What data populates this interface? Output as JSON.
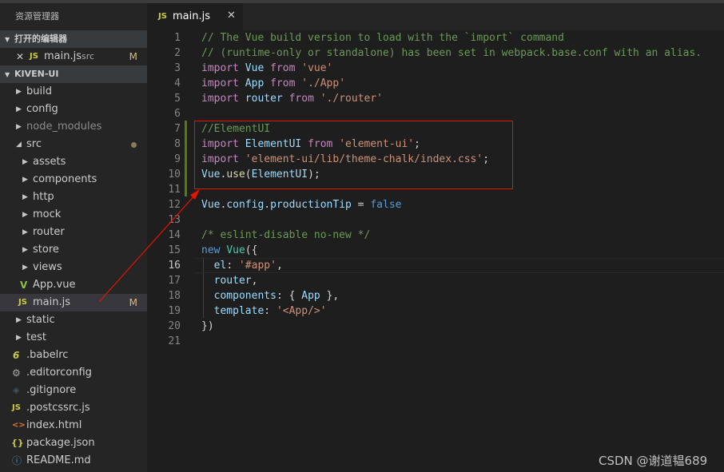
{
  "sidebar": {
    "title": "资源管理器",
    "open_editors": {
      "header": "打开的编辑器",
      "items": [
        {
          "name": "main.js",
          "folder": "src",
          "status": "M"
        }
      ]
    },
    "project": {
      "header": "KIVEN-UI",
      "tree": [
        {
          "name": "build"
        },
        {
          "name": "config"
        },
        {
          "name": "node_modules"
        },
        {
          "name": "src"
        },
        {
          "name": "assets"
        },
        {
          "name": "components"
        },
        {
          "name": "http"
        },
        {
          "name": "mock"
        },
        {
          "name": "router"
        },
        {
          "name": "store"
        },
        {
          "name": "views"
        },
        {
          "name": "App.vue"
        },
        {
          "name": "main.js",
          "status": "M"
        },
        {
          "name": "static"
        },
        {
          "name": "test"
        },
        {
          "name": ".babelrc"
        },
        {
          "name": ".editorconfig"
        },
        {
          "name": ".gitignore"
        },
        {
          "name": ".postcssrc.js"
        },
        {
          "name": "index.html"
        },
        {
          "name": "package.json"
        },
        {
          "name": "README.md"
        }
      ]
    }
  },
  "tab": {
    "label": "main.js",
    "icon": "JS",
    "close": "✕"
  },
  "icons": {
    "js": "JS",
    "vue": "V",
    "babel": "6",
    "gear": "⚙",
    "git": "◈",
    "html": "<>",
    "json": "{}",
    "info": "ⓘ",
    "close": "✕"
  },
  "editor": {
    "current_line": 16,
    "lines": [
      [
        [
          "c-com",
          "// The Vue build version to load with the `import` command"
        ]
      ],
      [
        [
          "c-com",
          "// (runtime-only or standalone) has been set in webpack.base.conf with an alias."
        ]
      ],
      [
        [
          "c-imp",
          "import"
        ],
        [
          "c-txt",
          " "
        ],
        [
          "c-var",
          "Vue"
        ],
        [
          "c-txt",
          " "
        ],
        [
          "c-imp",
          "from"
        ],
        [
          "c-txt",
          " "
        ],
        [
          "c-str",
          "'vue'"
        ]
      ],
      [
        [
          "c-imp",
          "import"
        ],
        [
          "c-txt",
          " "
        ],
        [
          "c-var",
          "App"
        ],
        [
          "c-txt",
          " "
        ],
        [
          "c-imp",
          "from"
        ],
        [
          "c-txt",
          " "
        ],
        [
          "c-str",
          "'./App'"
        ]
      ],
      [
        [
          "c-imp",
          "import"
        ],
        [
          "c-txt",
          " "
        ],
        [
          "c-var",
          "router"
        ],
        [
          "c-txt",
          " "
        ],
        [
          "c-imp",
          "from"
        ],
        [
          "c-txt",
          " "
        ],
        [
          "c-str",
          "'./router'"
        ]
      ],
      [],
      [
        [
          "c-com",
          "//ElementUI"
        ]
      ],
      [
        [
          "c-imp",
          "import"
        ],
        [
          "c-txt",
          " "
        ],
        [
          "c-var",
          "ElementUI"
        ],
        [
          "c-txt",
          " "
        ],
        [
          "c-imp",
          "from"
        ],
        [
          "c-txt",
          " "
        ],
        [
          "c-str",
          "'element-ui'"
        ],
        [
          "c-txt",
          ";"
        ]
      ],
      [
        [
          "c-imp",
          "import"
        ],
        [
          "c-txt",
          " "
        ],
        [
          "c-str",
          "'element-ui/lib/theme-chalk/index.css'"
        ],
        [
          "c-txt",
          ";"
        ]
      ],
      [
        [
          "c-var",
          "Vue"
        ],
        [
          "c-txt",
          "."
        ],
        [
          "c-fn",
          "use"
        ],
        [
          "c-txt",
          "("
        ],
        [
          "c-var",
          "ElementUI"
        ],
        [
          "c-txt",
          ");"
        ]
      ],
      [],
      [
        [
          "c-var",
          "Vue"
        ],
        [
          "c-txt",
          "."
        ],
        [
          "c-var",
          "config"
        ],
        [
          "c-txt",
          "."
        ],
        [
          "c-var",
          "productionTip"
        ],
        [
          "c-txt",
          " = "
        ],
        [
          "c-kw",
          "false"
        ]
      ],
      [],
      [
        [
          "c-com",
          "/* eslint-disable no-new */"
        ]
      ],
      [
        [
          "c-kw",
          "new"
        ],
        [
          "c-txt",
          " "
        ],
        [
          "c-cls",
          "Vue"
        ],
        [
          "c-txt",
          "({"
        ]
      ],
      [
        [
          "c-txt",
          "  "
        ],
        [
          "c-var",
          "el"
        ],
        [
          "c-txt",
          ": "
        ],
        [
          "c-str",
          "'#app'"
        ],
        [
          "c-txt",
          ","
        ]
      ],
      [
        [
          "c-txt",
          "  "
        ],
        [
          "c-var",
          "router"
        ],
        [
          "c-txt",
          ","
        ]
      ],
      [
        [
          "c-txt",
          "  "
        ],
        [
          "c-var",
          "components"
        ],
        [
          "c-txt",
          ": { "
        ],
        [
          "c-var",
          "App"
        ],
        [
          "c-txt",
          " },"
        ]
      ],
      [
        [
          "c-txt",
          "  "
        ],
        [
          "c-var",
          "template"
        ],
        [
          "c-txt",
          ": "
        ],
        [
          "c-str",
          "'<App/>'"
        ]
      ],
      [
        [
          "c-txt",
          "})"
        ]
      ],
      []
    ]
  },
  "watermark": "CSDN @谢道韫689",
  "colors": {
    "annotation": "#e51400",
    "modified": "#d7ba7d",
    "gutter_added": "#587c0c"
  }
}
